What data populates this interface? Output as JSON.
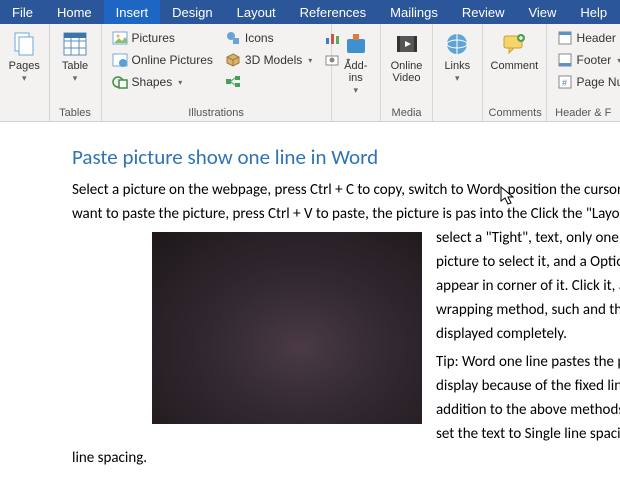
{
  "tabs": {
    "file": "File",
    "home": "Home",
    "insert": "Insert",
    "design": "Design",
    "layout": "Layout",
    "references": "References",
    "mailings": "Mailings",
    "review": "Review",
    "view": "View",
    "help": "Help"
  },
  "ribbon": {
    "pages": {
      "label": "Pages",
      "group": ""
    },
    "table": {
      "label": "Table",
      "group": "Tables"
    },
    "pictures": "Pictures",
    "online_pictures": "Online Pictures",
    "shapes": "Shapes",
    "icons": "Icons",
    "models": "3D Models",
    "illustrations_group": "Illustrations",
    "addins": {
      "label": "Add-\nins"
    },
    "online_video": {
      "label": "Online\nVideo",
      "group": "Media"
    },
    "links": "Links",
    "comment": {
      "label": "Comment",
      "group": "Comments"
    },
    "header": "Header",
    "footer": "Footer",
    "pagenum": "Page Nu",
    "headerfooter_group": "Header & F"
  },
  "doc": {
    "heading": "Paste picture show one line in Word",
    "body_html": "Select a picture on the webpage, press Ctrl + C to copy, switch to Word, position the cursor where you want to paste the picture, press Ctrl + V to paste, the picture is pas into the Click the \"Layout upper right select a \"Tight\", text, only one line is display picture to select it, and a Options\" icon will appear in corner of it. Click it, and the text wrapping method, such and the picture is displayed completely.",
    "tip": "Tip: Word one line pastes the picture to display because of the fixed line spacing. In addition to the above methods, you can also set the text to Single line spacing or Multiple line spacing."
  }
}
